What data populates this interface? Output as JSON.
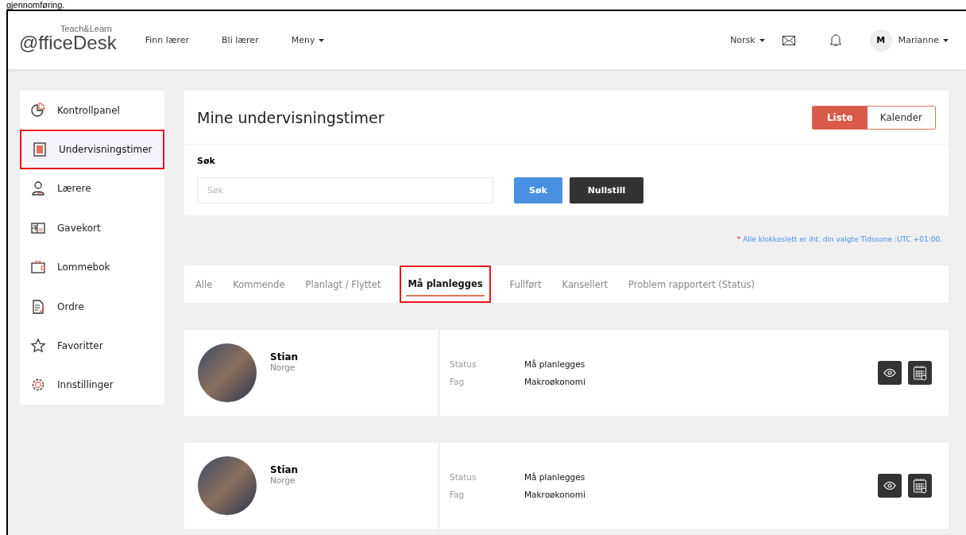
{
  "caption": "gjennomføring.",
  "header": {
    "logo": {
      "small": "Teach&Learn",
      "main": "@fficeDesk"
    },
    "nav": [
      {
        "label": "Finn lærer",
        "kind": "link"
      },
      {
        "label": "Bli lærer",
        "kind": "link"
      },
      {
        "label": "Meny",
        "kind": "dropdown"
      }
    ],
    "language": "Norsk",
    "user": {
      "initial": "M",
      "name": "Marianne"
    }
  },
  "sidebar": {
    "items": [
      {
        "label": "Kontrollpanel",
        "selected": false,
        "highlighted": false
      },
      {
        "label": "Undervisningstimer",
        "selected": true,
        "highlighted": true
      },
      {
        "label": "Lærere",
        "selected": false,
        "highlighted": false
      },
      {
        "label": "Gavekort",
        "selected": false,
        "highlighted": false
      },
      {
        "label": "Lommebok",
        "selected": false,
        "highlighted": false
      },
      {
        "label": "Ordre",
        "selected": false,
        "highlighted": false
      },
      {
        "label": "Favoritter",
        "selected": false,
        "highlighted": false
      },
      {
        "label": "Innstillinger",
        "selected": false,
        "highlighted": false
      }
    ]
  },
  "page": {
    "title": "Mine undervisningstimer",
    "view_toggle": [
      {
        "label": "Liste",
        "selected": true
      },
      {
        "label": "Kalender",
        "selected": false
      }
    ],
    "search": {
      "label": "Søk",
      "placeholder": "Søk",
      "buttons": [
        {
          "label": "Søk",
          "kind": "primary"
        },
        {
          "label": "Nullstill",
          "kind": "dark"
        }
      ]
    },
    "note": {
      "mark": "*",
      "text": "Alle klokkeslett er iht. din valgte Tidssone :UTC +01:00."
    },
    "tabs": [
      {
        "label": "Alle",
        "selected": false,
        "highlighted": false
      },
      {
        "label": "Kommende",
        "selected": false,
        "highlighted": false
      },
      {
        "label": "Planlagt / Flyttet",
        "selected": false,
        "highlighted": false
      },
      {
        "label": "Må planlegges",
        "selected": true,
        "highlighted": true
      },
      {
        "label": "Fullført",
        "selected": false,
        "highlighted": false
      },
      {
        "label": "Kansellert",
        "selected": false,
        "highlighted": false
      },
      {
        "label": "Problem rapportert (Status)",
        "selected": false,
        "highlighted": false
      }
    ],
    "lessons": [
      {
        "name": "Stian",
        "country": "Norge",
        "fields": [
          {
            "label": "Status",
            "value": "Må planlegges"
          },
          {
            "label": "Fag",
            "value": "Makroøkonomi"
          }
        ]
      },
      {
        "name": "Stian",
        "country": "Norge",
        "fields": [
          {
            "label": "Status",
            "value": "Må planlegges"
          },
          {
            "label": "Fag",
            "value": "Makroøkonomi"
          }
        ]
      }
    ]
  }
}
